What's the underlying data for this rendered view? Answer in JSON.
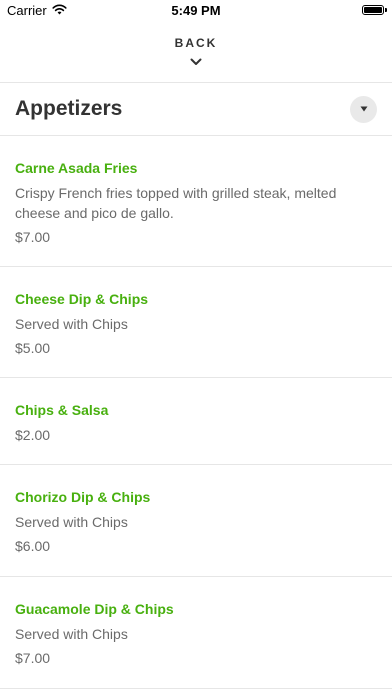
{
  "status_bar": {
    "carrier": "Carrier",
    "time": "5:49 PM"
  },
  "nav": {
    "back_label": "BACK"
  },
  "section": {
    "title": "Appetizers"
  },
  "items": [
    {
      "name": "Carne Asada Fries",
      "description": "Crispy French fries topped with grilled steak, melted cheese and pico de gallo.",
      "price": "$7.00"
    },
    {
      "name": "Cheese Dip & Chips",
      "description": "Served with Chips",
      "price": "$5.00"
    },
    {
      "name": "Chips & Salsa",
      "description": "",
      "price": "$2.00"
    },
    {
      "name": "Chorizo Dip & Chips",
      "description": "Served with Chips",
      "price": "$6.00"
    },
    {
      "name": "Guacamole Dip & Chips",
      "description": "Served with Chips",
      "price": "$7.00"
    }
  ],
  "colors": {
    "item_name": "#48b00f",
    "secondary_text": "#6a6a6a"
  }
}
